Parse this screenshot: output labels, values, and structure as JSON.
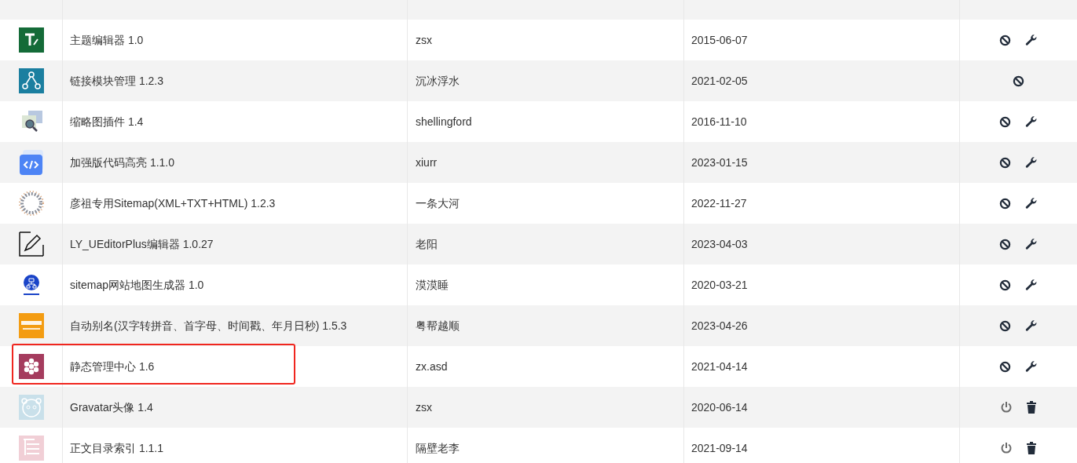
{
  "plugins": [
    {
      "name": "主题编辑器 1.0",
      "author": "zsx",
      "date": "2015-06-07",
      "actions": [
        {
          "kind": "disable"
        },
        {
          "kind": "settings"
        }
      ],
      "highlighted": false
    },
    {
      "name": "链接模块管理 1.2.3",
      "author": "沉冰浮水",
      "date": "2021-02-05",
      "actions": [
        {
          "kind": "disable"
        }
      ],
      "highlighted": false
    },
    {
      "name": "缩略图插件 1.4",
      "author": "shellingford",
      "date": "2016-11-10",
      "actions": [
        {
          "kind": "disable"
        },
        {
          "kind": "settings"
        }
      ],
      "highlighted": false
    },
    {
      "name": "加强版代码高亮 1.1.0",
      "author": "xiurr",
      "date": "2023-01-15",
      "actions": [
        {
          "kind": "disable"
        },
        {
          "kind": "settings"
        }
      ],
      "highlighted": false
    },
    {
      "name": "彦祖专用Sitemap(XML+TXT+HTML) 1.2.3",
      "author": "一条大河",
      "date": "2022-11-27",
      "actions": [
        {
          "kind": "disable"
        },
        {
          "kind": "settings"
        }
      ],
      "highlighted": false
    },
    {
      "name": "LY_UEditorPlus编辑器 1.0.27",
      "author": "老阳",
      "date": "2023-04-03",
      "actions": [
        {
          "kind": "disable"
        },
        {
          "kind": "settings"
        }
      ],
      "highlighted": false
    },
    {
      "name": "sitemap网站地图生成器 1.0",
      "author": "漠漠睡",
      "date": "2020-03-21",
      "actions": [
        {
          "kind": "disable"
        },
        {
          "kind": "settings"
        }
      ],
      "highlighted": false
    },
    {
      "name": "自动别名(汉字转拼音、首字母、时间戳、年月日秒) 1.5.3",
      "author": "粤帮越顺",
      "date": "2023-04-26",
      "actions": [
        {
          "kind": "disable"
        },
        {
          "kind": "settings"
        }
      ],
      "highlighted": false
    },
    {
      "name": "静态管理中心 1.6",
      "author": "zx.asd",
      "date": "2021-04-14",
      "actions": [
        {
          "kind": "disable"
        },
        {
          "kind": "settings"
        }
      ],
      "highlighted": true
    },
    {
      "name": "Gravatar头像 1.4",
      "author": "zsx",
      "date": "2020-06-14",
      "actions": [
        {
          "kind": "enable"
        },
        {
          "kind": "delete"
        }
      ],
      "highlighted": false
    },
    {
      "name": "正文目录索引 1.1.1",
      "author": "隔壁老李",
      "date": "2021-09-14",
      "actions": [
        {
          "kind": "enable"
        },
        {
          "kind": "delete"
        }
      ],
      "highlighted": false
    }
  ]
}
